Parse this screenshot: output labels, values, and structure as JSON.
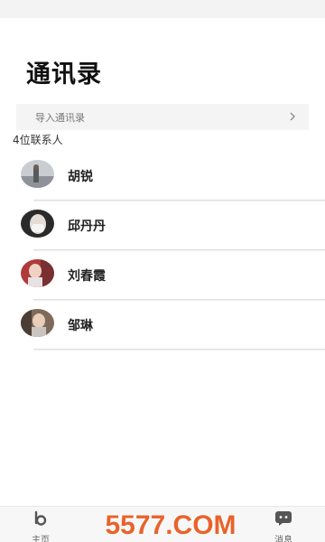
{
  "page": {
    "title": "通讯录"
  },
  "import": {
    "label": "导入通讯录"
  },
  "contacts": {
    "count_label": "4位联系人",
    "items": [
      {
        "name": "胡锐"
      },
      {
        "name": "邱丹丹"
      },
      {
        "name": "刘春霞"
      },
      {
        "name": "邹琳"
      }
    ]
  },
  "nav": {
    "home_label": "主页",
    "messages_label": "消息"
  },
  "watermark": {
    "text": "5577.COM"
  },
  "colors": {
    "accent": "#e8632b",
    "nav_icon": "#555555"
  }
}
